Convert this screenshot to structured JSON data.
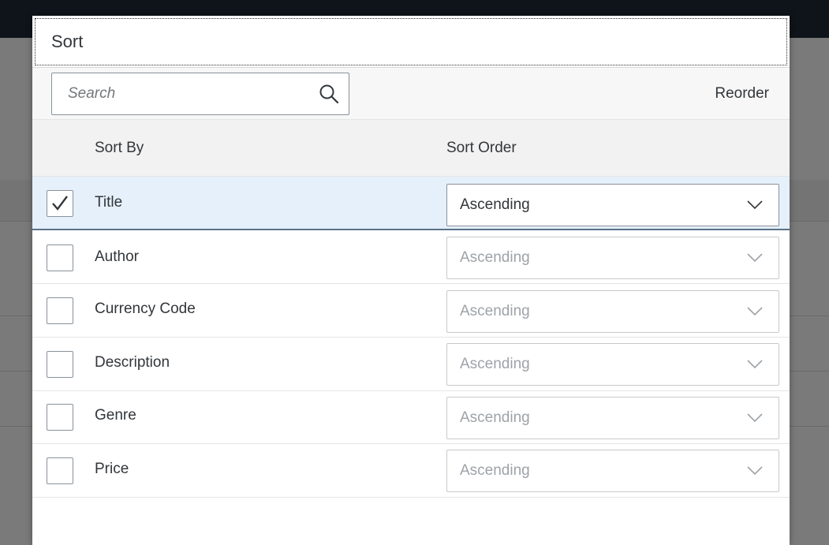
{
  "dialog": {
    "title": "Sort"
  },
  "toolbar": {
    "search_placeholder": "Search",
    "reorder_label": "Reorder"
  },
  "table": {
    "headers": {
      "sort_by": "Sort By",
      "sort_order": "Sort Order"
    },
    "rows": [
      {
        "label": "Title",
        "checked": true,
        "order": "Ascending",
        "enabled": true
      },
      {
        "label": "Author",
        "checked": false,
        "order": "Ascending",
        "enabled": false
      },
      {
        "label": "Currency Code",
        "checked": false,
        "order": "Ascending",
        "enabled": false
      },
      {
        "label": "Description",
        "checked": false,
        "order": "Ascending",
        "enabled": false
      },
      {
        "label": "Genre",
        "checked": false,
        "order": "Ascending",
        "enabled": false
      },
      {
        "label": "Price",
        "checked": false,
        "order": "Ascending",
        "enabled": false
      }
    ]
  },
  "icons": {
    "search": "search-icon",
    "checkmark": "checkmark-icon",
    "dropdown": "chevron-down-icon"
  },
  "colors": {
    "shell_bar": "#0f141a",
    "selected_row": "#e5f0fa",
    "text": "#32363a",
    "disabled_text": "#9ea3a8"
  }
}
